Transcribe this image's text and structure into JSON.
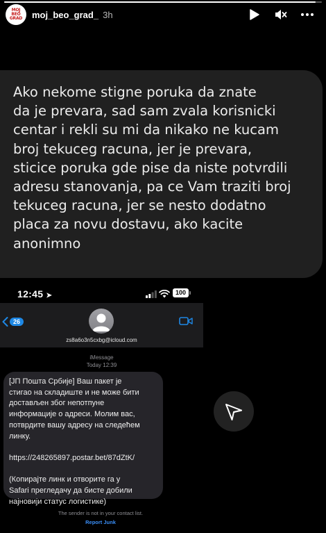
{
  "story": {
    "progress": 0.98,
    "username": "moj_beo_grad_",
    "time_ago": "3h",
    "avatar_lines": [
      "MOJ",
      "BEO",
      "GRAD"
    ]
  },
  "message_overlay": {
    "text": "Ako nekome stigne poruka da znate\nda je prevara, sad sam zvala korisnicki\ncentar i rekli su mi da nikako ne kucam\nbroj tekuceg racuna, jer je prevara,\nsticice poruka gde pise da niste potvrdili\nadresu stanovanja, pa ce Vam traziti broj\ntekuceg racuna, jer se nesto dodatno\nplaca za novu dostavu, ako kacite\nanonimno"
  },
  "phone": {
    "status_time": "12:45",
    "battery": "100",
    "back_count": "26",
    "contact_email": "zs8a6o3n5cxbg@icloud.com",
    "service": "iMessage",
    "timestamp": "Today 12:39",
    "message": "[ЈП Пошта Србије] Ваш пакет је\nстигао на складиште и не може бити\nдостављен због непотпуне\nинформације о адреси. Молим вас,\nпотврдите вашу адресу на следећем\nлинку.\n\nhttps://248265897.postar.bet/87dZtK/\n\n(Копирајте линк и отворите га у\nSafari прегледачу да бисте добили\nнајновији статус логистике)",
    "sender_note": "The sender is not in your contact list.",
    "report_junk": "Report Junk"
  },
  "icons": {
    "play": "play-icon",
    "mute": "mute-icon",
    "more": "more-icon",
    "send": "send-icon",
    "video": "video-icon"
  },
  "colors": {
    "bubble": "#202020",
    "sms_bubble": "#26252a",
    "badge_blue": "#1e88e5",
    "avatar_red": "#c51a1a"
  }
}
